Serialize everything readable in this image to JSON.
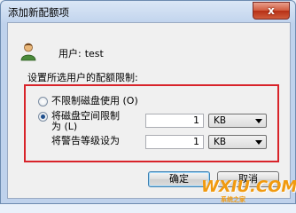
{
  "window": {
    "title": "添加新配额项"
  },
  "titlebar": {
    "close_glyph": "x"
  },
  "user": {
    "label": "用户:",
    "value": "test"
  },
  "setting_label": "设置所选用户的配额限制:",
  "options": {
    "no_limit_label": "不限制磁盘使用 (O)",
    "limit_label_line1": "将磁盘空间限制",
    "limit_label_line2": "为 (L)",
    "limit_value": "1",
    "limit_unit": "KB",
    "warning_label": "将警告等级设为",
    "warning_value": "1",
    "warning_unit": "KB",
    "selected": "limit"
  },
  "buttons": {
    "ok": "确定",
    "cancel": "取消"
  },
  "watermark": {
    "main": "WXIU.COM",
    "sub": "系统之家"
  },
  "colors": {
    "highlight_border": "#d8232a",
    "watermark": "#f19a0f"
  },
  "icons": {
    "user": "user-icon",
    "close": "close-icon",
    "dropdown": "chevron-down-icon"
  }
}
